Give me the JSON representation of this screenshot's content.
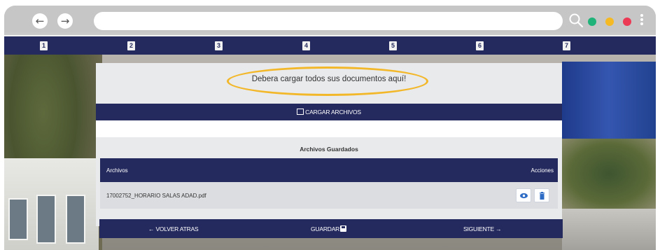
{
  "browser": {
    "back_glyph": "←",
    "forward_glyph": "→",
    "icons": [
      "back-icon",
      "forward-icon",
      "search-icon",
      "kebab-menu-icon"
    ],
    "dot_colors": [
      "#1fb37a",
      "#f5b923",
      "#ec3a55"
    ]
  },
  "steps": [
    "1",
    "2",
    "3",
    "4",
    "5",
    "6",
    "7"
  ],
  "panel": {
    "title": "Debera cargar todos sus documentos aquí!",
    "upload_label": "CARGAR ARCHIVOS",
    "saved_title": "Archivos Guardados",
    "table": {
      "columns": [
        "Archivos",
        "Acciones"
      ],
      "rows": [
        {
          "file": "17002752_HORARIO SALAS ADAD.pdf"
        }
      ]
    }
  },
  "footer": {
    "back_label": "← VOLVER ATRAS",
    "save_label": "GUARDAR",
    "next_label": "SIGUIENTE →"
  },
  "colors": {
    "navy": "#242a5e",
    "highlight": "#f3b72a",
    "action_blue": "#2d6bc4"
  }
}
